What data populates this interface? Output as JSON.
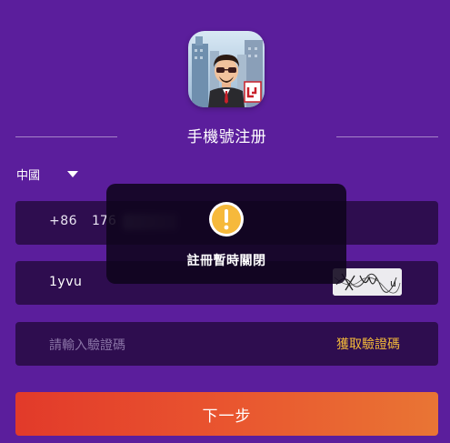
{
  "header": {
    "title": "手機號注册"
  },
  "country": {
    "selected": "中國"
  },
  "phone": {
    "prefix": "+86",
    "value": "176"
  },
  "captcha": {
    "value": "1yvu",
    "image_text": "x y u"
  },
  "sms": {
    "placeholder": "請輸入驗證碼",
    "button_label": "獲取驗證碼"
  },
  "next_button": {
    "label": "下一步"
  },
  "toast": {
    "message": "註冊暫時關閉"
  },
  "colors": {
    "background": "#5b1e9c",
    "field": "#2e0d4f",
    "accent": "#f3b93a",
    "button_start": "#e23a2a",
    "button_end": "#e97534"
  }
}
